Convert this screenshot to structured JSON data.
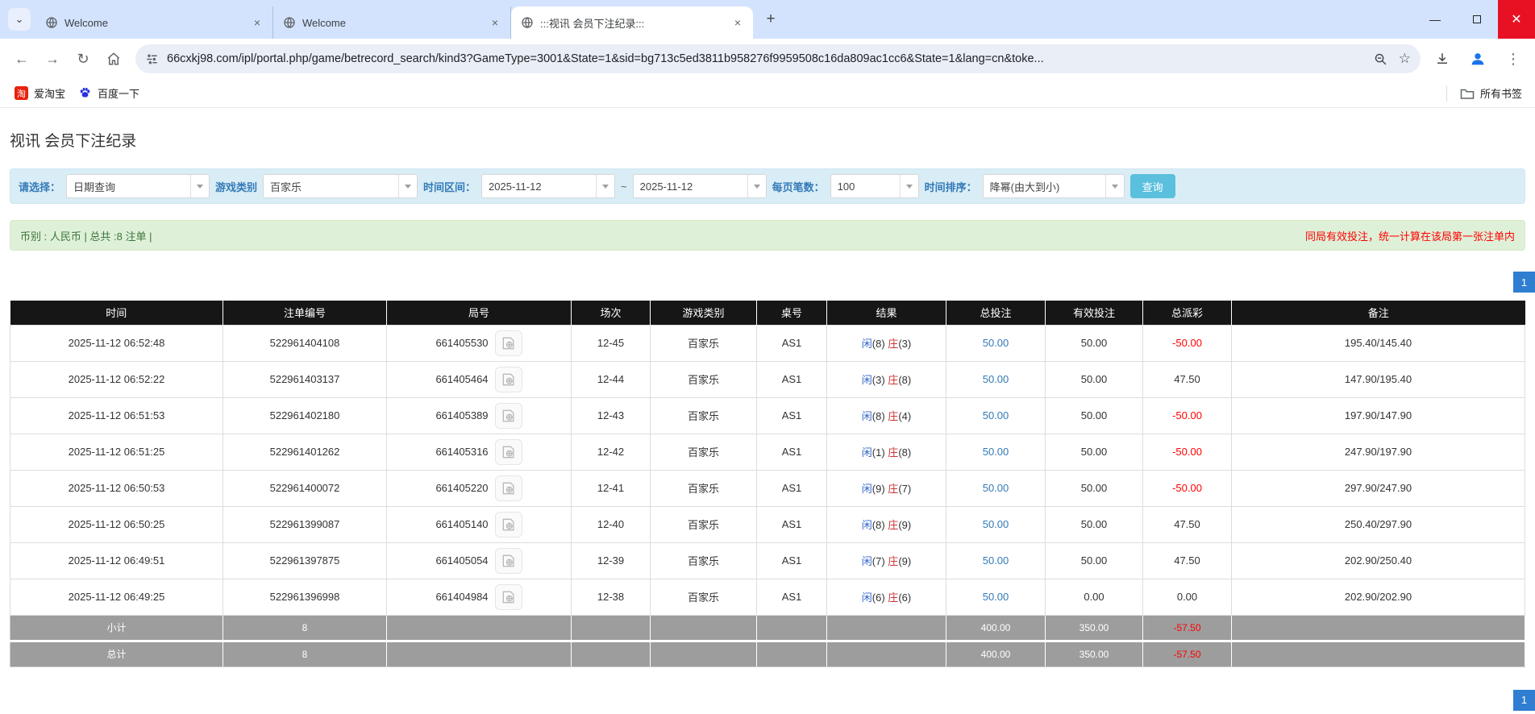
{
  "browser": {
    "tabs": [
      {
        "title": "Welcome",
        "active": false
      },
      {
        "title": "Welcome",
        "active": false
      },
      {
        "title": ":::视讯 会员下注纪录:::",
        "active": true
      }
    ],
    "url": "66cxkj98.com/ipl/portal.php/game/betrecord_search/kind3?GameType=3001&State=1&sid=bg713c5ed3811b958276f9959508c16da809ac1cc6&State=1&lang=cn&toke...",
    "bookmarks": [
      {
        "label": "爱淘宝",
        "favicon_text": "淘"
      },
      {
        "label": "百度一下"
      }
    ],
    "all_bookmarks_label": "所有书签"
  },
  "page": {
    "title": "视讯 会员下注纪录",
    "filters": {
      "select_label": "请选择：",
      "select_value": "日期查询",
      "game_type_label": "游戏类别",
      "game_type_value": "百家乐",
      "date_range_label": "时间区间：",
      "date_from": "2025-11-12",
      "tilde": "~",
      "date_to": "2025-11-12",
      "page_size_label": "每页笔数：",
      "page_size_value": "100",
      "sort_label": "时间排序：",
      "sort_value": "降幂(由大到小)",
      "search_button": "查询"
    },
    "summary": "币别 : 人民币 | 总共 :8 注单 |",
    "notice": "同局有效投注，统一计算在该局第一张注单内",
    "pagination": "1"
  },
  "table": {
    "headers": [
      "时间",
      "注单编号",
      "局号",
      "场次",
      "游戏类别",
      "桌号",
      "结果",
      "总投注",
      "有效投注",
      "总派彩",
      "备注"
    ],
    "rows": [
      {
        "time": "2025-11-12 06:52:48",
        "bet_id": "522961404108",
        "round": "661405530",
        "session": "12-45",
        "game": "百家乐",
        "table_no": "AS1",
        "player": "闲",
        "player_n": "(8)",
        "banker": "庄",
        "banker_n": "(3)",
        "total_bet": "50.00",
        "valid_bet": "50.00",
        "payout": "-50.00",
        "remark": "195.40/145.40"
      },
      {
        "time": "2025-11-12 06:52:22",
        "bet_id": "522961403137",
        "round": "661405464",
        "session": "12-44",
        "game": "百家乐",
        "table_no": "AS1",
        "player": "闲",
        "player_n": "(3)",
        "banker": "庄",
        "banker_n": "(8)",
        "total_bet": "50.00",
        "valid_bet": "50.00",
        "payout": "47.50",
        "remark": "147.90/195.40"
      },
      {
        "time": "2025-11-12 06:51:53",
        "bet_id": "522961402180",
        "round": "661405389",
        "session": "12-43",
        "game": "百家乐",
        "table_no": "AS1",
        "player": "闲",
        "player_n": "(8)",
        "banker": "庄",
        "banker_n": "(4)",
        "total_bet": "50.00",
        "valid_bet": "50.00",
        "payout": "-50.00",
        "remark": "197.90/147.90"
      },
      {
        "time": "2025-11-12 06:51:25",
        "bet_id": "522961401262",
        "round": "661405316",
        "session": "12-42",
        "game": "百家乐",
        "table_no": "AS1",
        "player": "闲",
        "player_n": "(1)",
        "banker": "庄",
        "banker_n": "(8)",
        "total_bet": "50.00",
        "valid_bet": "50.00",
        "payout": "-50.00",
        "remark": "247.90/197.90"
      },
      {
        "time": "2025-11-12 06:50:53",
        "bet_id": "522961400072",
        "round": "661405220",
        "session": "12-41",
        "game": "百家乐",
        "table_no": "AS1",
        "player": "闲",
        "player_n": "(9)",
        "banker": "庄",
        "banker_n": "(7)",
        "total_bet": "50.00",
        "valid_bet": "50.00",
        "payout": "-50.00",
        "remark": "297.90/247.90"
      },
      {
        "time": "2025-11-12 06:50:25",
        "bet_id": "522961399087",
        "round": "661405140",
        "session": "12-40",
        "game": "百家乐",
        "table_no": "AS1",
        "player": "闲",
        "player_n": "(8)",
        "banker": "庄",
        "banker_n": "(9)",
        "total_bet": "50.00",
        "valid_bet": "50.00",
        "payout": "47.50",
        "remark": "250.40/297.90"
      },
      {
        "time": "2025-11-12 06:49:51",
        "bet_id": "522961397875",
        "round": "661405054",
        "session": "12-39",
        "game": "百家乐",
        "table_no": "AS1",
        "player": "闲",
        "player_n": "(7)",
        "banker": "庄",
        "banker_n": "(9)",
        "total_bet": "50.00",
        "valid_bet": "50.00",
        "payout": "47.50",
        "remark": "202.90/250.40"
      },
      {
        "time": "2025-11-12 06:49:25",
        "bet_id": "522961396998",
        "round": "661404984",
        "session": "12-38",
        "game": "百家乐",
        "table_no": "AS1",
        "player": "闲",
        "player_n": "(6)",
        "banker": "庄",
        "banker_n": "(6)",
        "total_bet": "50.00",
        "valid_bet": "0.00",
        "payout": "0.00",
        "remark": "202.90/202.90"
      }
    ],
    "subtotal": {
      "label": "小计",
      "count": "8",
      "total_bet": "400.00",
      "valid_bet": "350.00",
      "payout": "-57.50"
    },
    "total": {
      "label": "总计",
      "count": "8",
      "total_bet": "400.00",
      "valid_bet": "350.00",
      "payout": "-57.50"
    }
  },
  "colors": {
    "tabstrip_bg": "#d3e3fd",
    "accent_blue": "#337ab7",
    "search_btn": "#5bc0de",
    "header_bg": "#161616",
    "footer_bg": "#9d9d9d",
    "negative": "#ff0000",
    "player_blue": "#3366cc",
    "banker_red": "#cc3333"
  }
}
